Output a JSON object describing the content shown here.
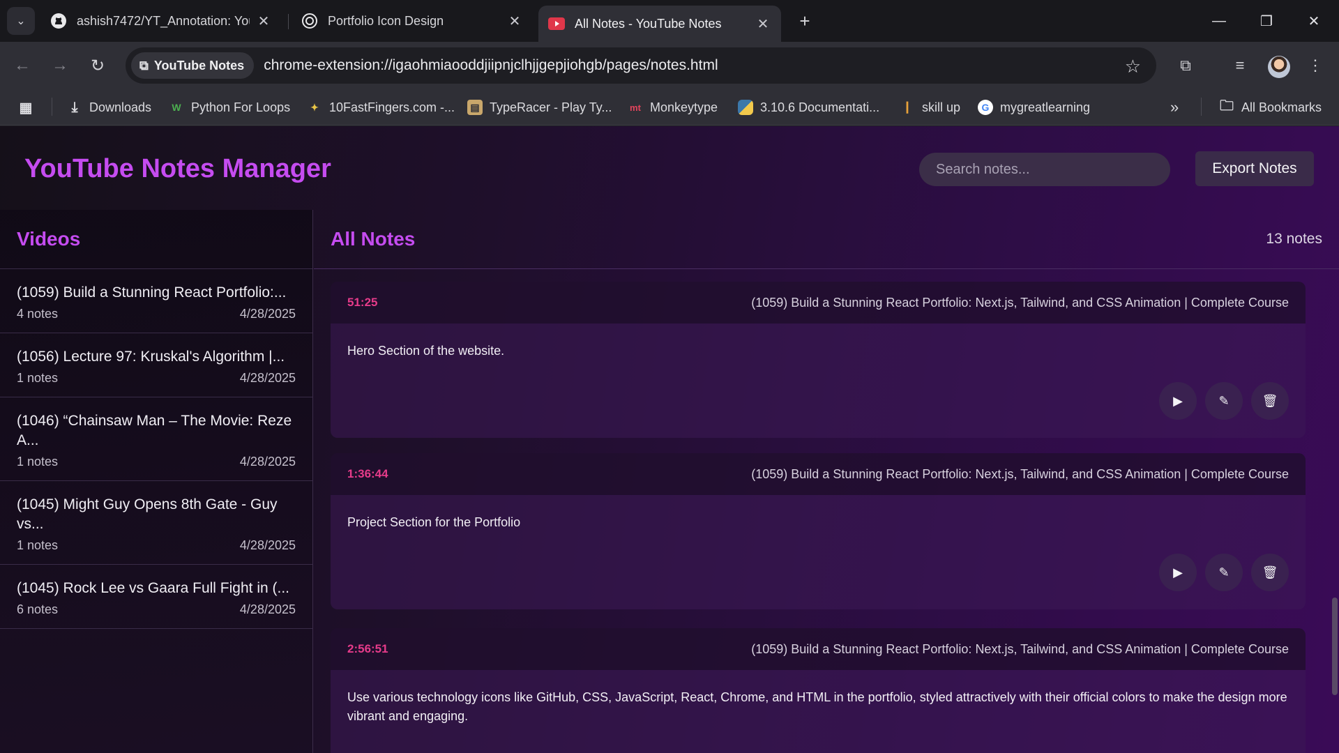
{
  "browser": {
    "tabs": [
      {
        "title": "ashish7472/YT_Annotation: You",
        "icon": "github-icon"
      },
      {
        "title": "Portfolio Icon Design",
        "icon": "openai-icon"
      },
      {
        "title": "All Notes - YouTube Notes",
        "icon": "youtube-icon",
        "active": true
      }
    ],
    "site_chip": "YouTube Notes",
    "url": "chrome-extension://igaohmiaooddjiipnjclhjjgepjiohgb/pages/notes.html",
    "bookmarks": [
      {
        "label": "Downloads",
        "icon": "download-icon"
      },
      {
        "label": "Python For Loops",
        "icon": "w3schools-icon"
      },
      {
        "label": "10FastFingers.com -...",
        "icon": "10fastfingers-icon"
      },
      {
        "label": "TypeRacer - Play Ty...",
        "icon": "typeracer-icon"
      },
      {
        "label": "Monkeytype",
        "icon": "monkeytype-icon"
      },
      {
        "label": "3.10.6 Documentati...",
        "icon": "python-icon"
      },
      {
        "label": "skill up",
        "icon": "skillup-icon"
      },
      {
        "label": "mygreatlearning",
        "icon": "google-icon"
      }
    ],
    "all_bookmarks": "All Bookmarks"
  },
  "app": {
    "title": "YouTube Notes Manager",
    "search_placeholder": "Search notes...",
    "export_label": "Export Notes"
  },
  "sidebar": {
    "heading": "Videos",
    "videos": [
      {
        "title": "(1059) Build a Stunning React Portfolio:...",
        "count": "4 notes",
        "date": "4/28/2025"
      },
      {
        "title": "(1056) Lecture 97: Kruskal's Algorithm |...",
        "count": "1 notes",
        "date": "4/28/2025"
      },
      {
        "title": "(1046) “Chainsaw Man – The Movie: Reze A...",
        "count": "1 notes",
        "date": "4/28/2025"
      },
      {
        "title": "(1045) Might Guy Opens 8th Gate - Guy vs...",
        "count": "1 notes",
        "date": "4/28/2025"
      },
      {
        "title": "(1045) Rock Lee vs Gaara Full Fight in (...",
        "count": "6 notes",
        "date": "4/28/2025"
      }
    ]
  },
  "main": {
    "heading": "All Notes",
    "count": "13 notes",
    "notes": [
      {
        "time": "51:25",
        "video": "(1059) Build a Stunning React Portfolio: Next.js, Tailwind, and CSS Animation | Complete Course",
        "text": "Hero Section of the website."
      },
      {
        "time": "1:36:44",
        "video": "(1059) Build a Stunning React Portfolio: Next.js, Tailwind, and CSS Animation | Complete Course",
        "text": "Project Section for the Portfolio"
      },
      {
        "time": "2:56:51",
        "video": "(1059) Build a Stunning React Portfolio: Next.js, Tailwind, and CSS Animation | Complete Course",
        "text": "Use various technology icons like GitHub, CSS, JavaScript, React, Chrome, and HTML in the portfolio, styled attractively with their official colors to make the design more vibrant and engaging."
      }
    ]
  },
  "colors": {
    "accent": "#c54cf0",
    "timestamp": "#e63b8a"
  }
}
